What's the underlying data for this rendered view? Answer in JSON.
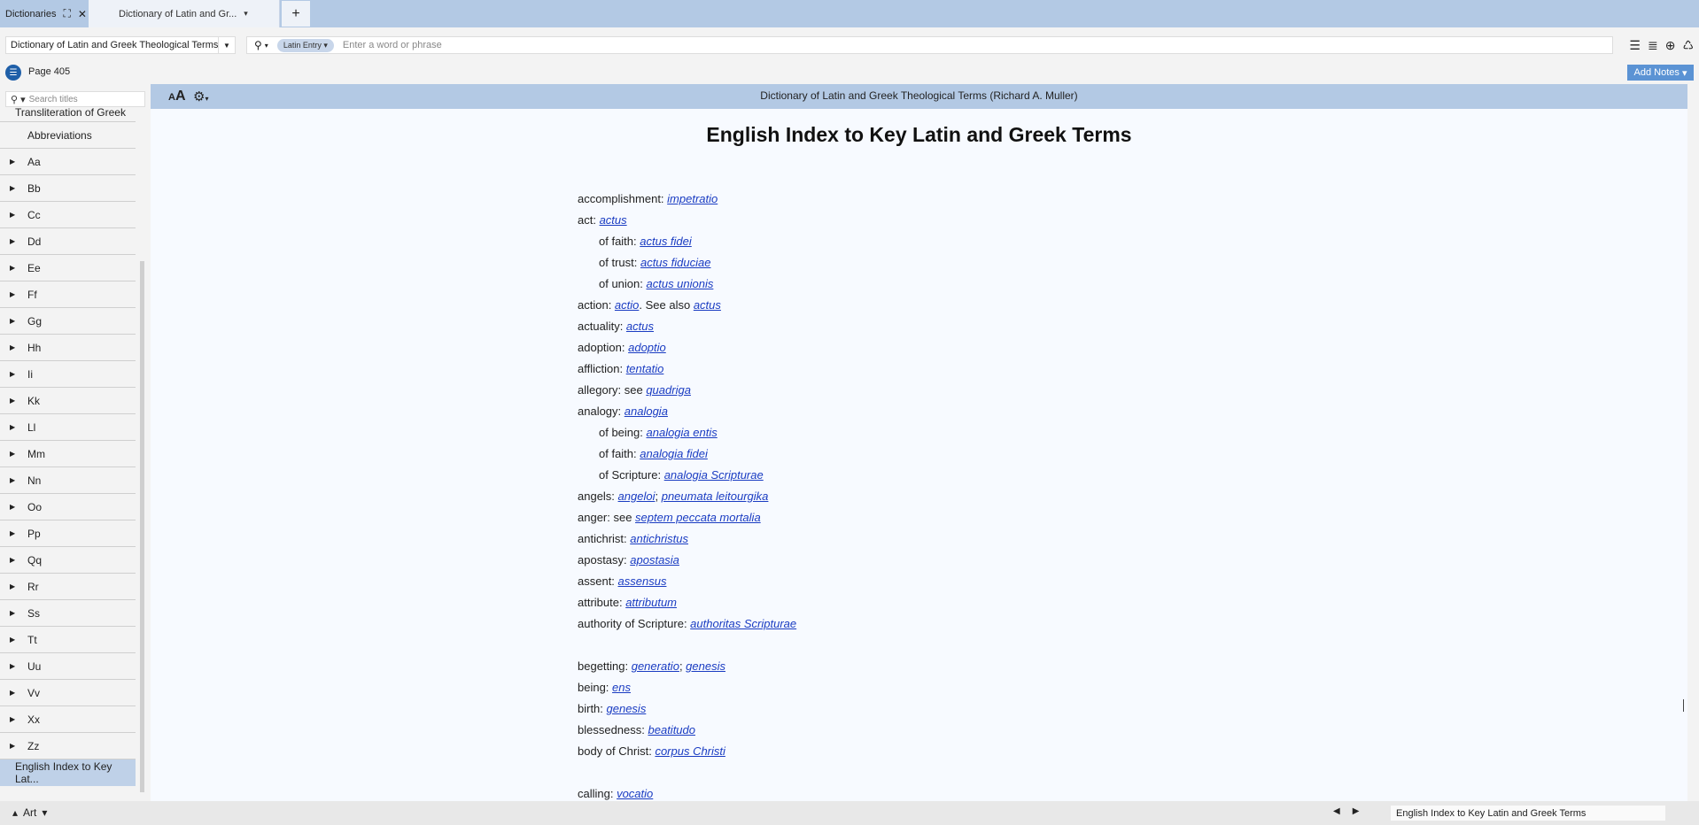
{
  "tabs": {
    "dictionaries_label": "Dictionaries",
    "active_tab_label": "Dictionary of Latin and Gr...",
    "new_tab": "+"
  },
  "toolbar": {
    "book_name": "Dictionary of Latin and Greek Theological Terms",
    "search_type": "Latin Entry",
    "search_placeholder": "Enter a word or phrase"
  },
  "pagebar": {
    "page_label": "Page 405",
    "add_notes_label": "Add Notes"
  },
  "sidebar": {
    "search_placeholder": "Search titles",
    "top_item": "Transliteration of Greek",
    "items": [
      "Abbreviations",
      "Aa",
      "Bb",
      "Cc",
      "Dd",
      "Ee",
      "Ff",
      "Gg",
      "Hh",
      "Ii",
      "Kk",
      "Ll",
      "Mm",
      "Nn",
      "Oo",
      "Pp",
      "Qq",
      "Rr",
      "Ss",
      "Tt",
      "Uu",
      "Vv",
      "Xx",
      "Zz"
    ],
    "selected_item": "English Index to Key Lat..."
  },
  "reader": {
    "book_title": "Dictionary of Latin and Greek Theological Terms (Richard A. Muller)",
    "heading": "English Index to Key Latin and Greek Terms",
    "entries": [
      {
        "text": "accomplishment: ",
        "links": [
          "impetratio"
        ]
      },
      {
        "text": "act: ",
        "links": [
          "actus"
        ]
      },
      {
        "text": "of faith: ",
        "links": [
          "actus fidei"
        ],
        "sub": true
      },
      {
        "text": "of trust: ",
        "links": [
          "actus fiduciae"
        ],
        "sub": true
      },
      {
        "text": "of union: ",
        "links": [
          "actus unionis"
        ],
        "sub": true
      },
      {
        "text": "action: ",
        "links": [
          "actio",
          "actus"
        ],
        "sep": ". See also "
      },
      {
        "text": "actuality: ",
        "links": [
          "actus"
        ]
      },
      {
        "text": "adoption: ",
        "links": [
          "adoptio"
        ]
      },
      {
        "text": "affliction: ",
        "links": [
          "tentatio"
        ]
      },
      {
        "text": "allegory: see ",
        "links": [
          "quadriga"
        ]
      },
      {
        "text": "analogy: ",
        "links": [
          "analogia"
        ]
      },
      {
        "text": "of being: ",
        "links": [
          "analogia entis"
        ],
        "sub": true
      },
      {
        "text": "of faith: ",
        "links": [
          "analogia fidei"
        ],
        "sub": true
      },
      {
        "text": "of Scripture: ",
        "links": [
          "analogia Scripturae"
        ],
        "sub": true
      },
      {
        "text": "angels: ",
        "links": [
          "angeloi",
          "pneumata leitourgika"
        ],
        "sep": "; "
      },
      {
        "text": "anger: see ",
        "links": [
          "septem peccata mortalia"
        ]
      },
      {
        "text": "antichrist: ",
        "links": [
          "antichristus"
        ]
      },
      {
        "text": "apostasy: ",
        "links": [
          "apostasia"
        ]
      },
      {
        "text": "assent: ",
        "links": [
          "assensus"
        ]
      },
      {
        "text": "attribute: ",
        "links": [
          "attributum"
        ]
      },
      {
        "text": "authority of Scripture: ",
        "links": [
          "authoritas Scripturae"
        ]
      },
      {
        "gap": true
      },
      {
        "text": "begetting: ",
        "links": [
          "generatio",
          "genesis"
        ],
        "sep": "; "
      },
      {
        "text": "being: ",
        "links": [
          "ens"
        ]
      },
      {
        "text": "birth: ",
        "links": [
          "genesis"
        ]
      },
      {
        "text": "blessedness: ",
        "links": [
          "beatitudo"
        ]
      },
      {
        "text": "body of Christ: ",
        "links": [
          "corpus Christi"
        ]
      },
      {
        "gap": true
      },
      {
        "text": "calling: ",
        "links": [
          "vocatio"
        ]
      }
    ]
  },
  "statusbar": {
    "art_label": "Art",
    "current_title": "English Index to Key Latin and Greek Terms"
  }
}
